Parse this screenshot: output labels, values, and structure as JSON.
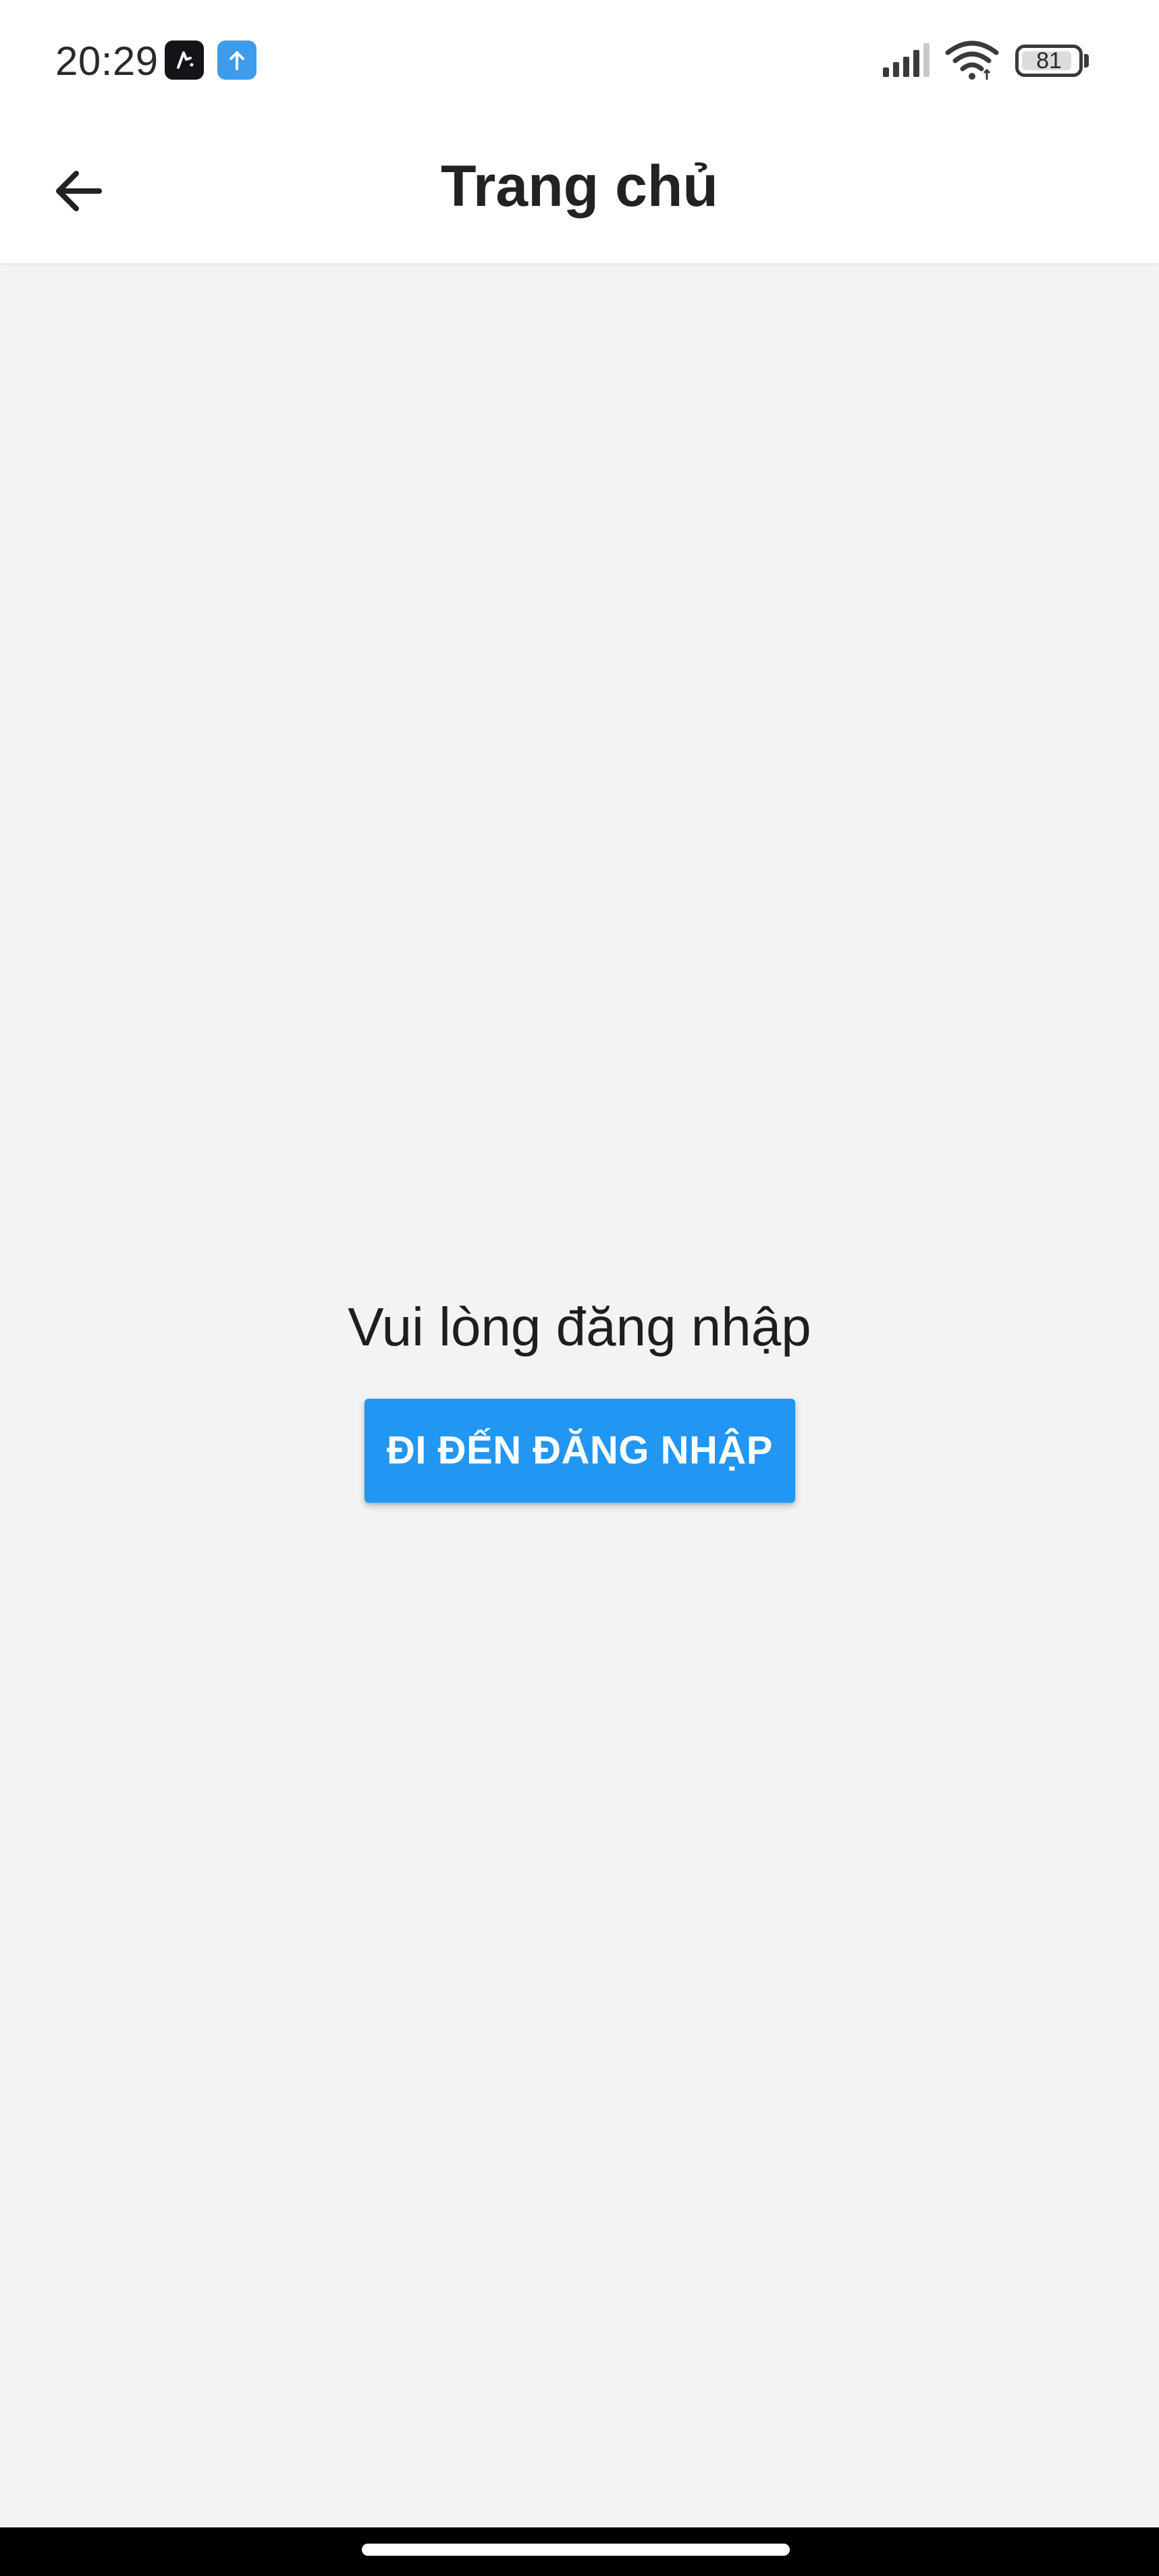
{
  "status_bar": {
    "time": "20:29",
    "battery_level": "81",
    "notification_icons": [
      "dark-app-icon",
      "upload-arrow-icon"
    ],
    "system_icons": [
      "signal-icon",
      "wifi-icon",
      "battery-icon"
    ]
  },
  "app_bar": {
    "title": "Trang chủ",
    "back_icon": "arrow-back-icon"
  },
  "main": {
    "message": "Vui lòng đăng nhập",
    "login_button_label": "ĐI ĐẾN ĐĂNG NHẬP"
  },
  "colors": {
    "accent": "#2196f3",
    "background": "#f3f3f3",
    "app_bar": "#ffffff",
    "text": "#1e1e1e"
  }
}
